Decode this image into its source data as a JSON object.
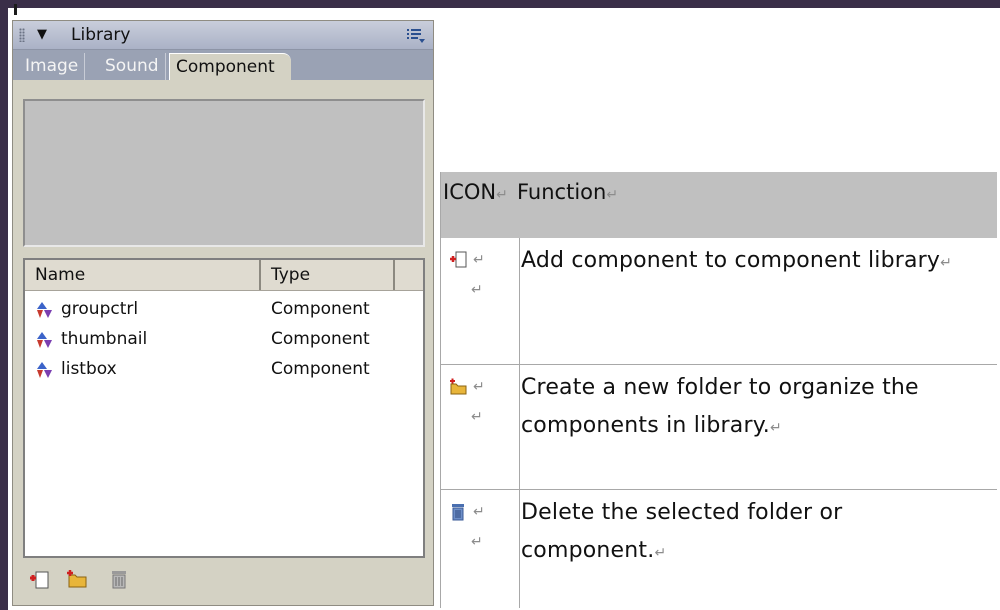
{
  "library_panel": {
    "title": "Library",
    "tabs": [
      "Image",
      "Sound",
      "Component"
    ],
    "active_tab": "Component",
    "columns": [
      "Name",
      "Type"
    ],
    "items": [
      {
        "name": "groupctrl",
        "type": "Component",
        "icon": "component-icon"
      },
      {
        "name": "thumbnail",
        "type": "Component",
        "icon": "component-icon"
      },
      {
        "name": "listbox",
        "type": "Component",
        "icon": "component-icon"
      }
    ],
    "toolbar": [
      "add-component-icon",
      "new-folder-icon",
      "delete-icon"
    ]
  },
  "function_table": {
    "header": {
      "icon": "ICON",
      "function": "Function"
    },
    "paragraph_mark": "↵",
    "cell_mark": "↵",
    "rows": [
      {
        "icon": "add-component-icon",
        "text": "Add component to component library"
      },
      {
        "icon": "new-folder-icon",
        "text": "Create a new folder to organize the components in library."
      },
      {
        "icon": "delete-icon",
        "text": "Delete the selected folder or component."
      }
    ]
  },
  "colors": {
    "frame": "#3a2e48",
    "panel": "#d4d2c4",
    "tab_bar": "#9aa2b4",
    "table_header": "#c0c0c0"
  }
}
